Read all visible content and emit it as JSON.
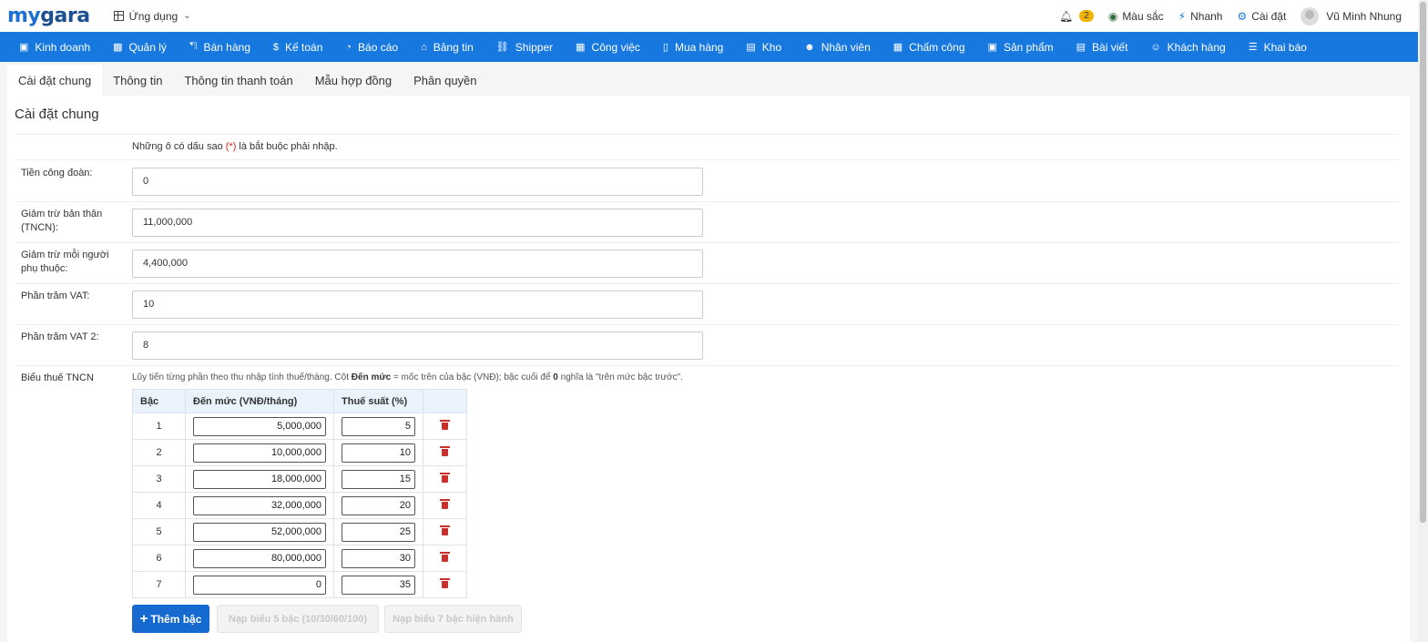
{
  "brand": {
    "logo_my": "my",
    "logo_gara": "gara"
  },
  "topbar": {
    "apps_label": "Ứng dụng",
    "notification_count": "2",
    "color_label": "Màu sắc",
    "quick_label": "Nhanh",
    "settings_label": "Cài đặt",
    "user_name": "Vũ Minh Nhung"
  },
  "nav": [
    {
      "label": "Kinh doanh",
      "icon": "briefcase-icon"
    },
    {
      "label": "Quản lý",
      "icon": "id-card-icon"
    },
    {
      "label": "Bán hàng",
      "icon": "cart-icon"
    },
    {
      "label": "Kế toán",
      "icon": "dollar-icon"
    },
    {
      "label": "Báo cáo",
      "icon": "pie-chart-icon"
    },
    {
      "label": "Bảng tin",
      "icon": "home-icon"
    },
    {
      "label": "Shipper",
      "icon": "truck-icon"
    },
    {
      "label": "Công việc",
      "icon": "calendar-icon"
    },
    {
      "label": "Mua hàng",
      "icon": "basket-icon"
    },
    {
      "label": "Kho",
      "icon": "warehouse-icon"
    },
    {
      "label": "Nhân viên",
      "icon": "user-icon"
    },
    {
      "label": "Chấm công",
      "icon": "calendar-check-icon"
    },
    {
      "label": "Sản phẩm",
      "icon": "box-icon"
    },
    {
      "label": "Bài viết",
      "icon": "newspaper-icon"
    },
    {
      "label": "Khách hàng",
      "icon": "smile-icon"
    },
    {
      "label": "Khai báo",
      "icon": "list-icon"
    }
  ],
  "tabs": [
    {
      "label": "Cài đặt chung",
      "active": true
    },
    {
      "label": "Thông tin"
    },
    {
      "label": "Thông tin thanh toán"
    },
    {
      "label": "Mẫu hợp đồng"
    },
    {
      "label": "Phân quyền"
    }
  ],
  "panel": {
    "title": "Cài đặt chung",
    "required_note_pre": "Những ô có dấu sao ",
    "required_note_star": "(*)",
    "required_note_post": " là bắt buộc phải nhập.",
    "fields": {
      "union_fee": {
        "label": "Tiền công đoàn:",
        "value": "0"
      },
      "self_deduction": {
        "label": "Giảm trừ bản thân (TNCN):",
        "value": "11,000,000"
      },
      "dependent_deduction": {
        "label": "Giảm trừ mỗi người phụ thuộc:",
        "value": "4,400,000"
      },
      "vat_percent": {
        "label": "Phần trăm VAT:",
        "value": "10"
      },
      "vat_percent_2": {
        "label": "Phần trăm VAT 2:",
        "value": "8"
      }
    },
    "tax_table": {
      "label": "Biểu thuế TNCN",
      "desc_1": "Lũy tiến từng phần theo thu nhập tính thuế/tháng. Cột ",
      "desc_bold_1": "Đến mức",
      "desc_2": " = mốc trên của bậc (VNĐ); bậc cuối để ",
      "desc_bold_2": "0",
      "desc_3": " nghĩa là \"trên mức bậc trước\".",
      "headers": {
        "level": "Bậc",
        "up_to": "Đến mức (VNĐ/tháng)",
        "rate": "Thuế suất (%)"
      },
      "rows": [
        {
          "level": "1",
          "up_to": "5,000,000",
          "rate": "5"
        },
        {
          "level": "2",
          "up_to": "10,000,000",
          "rate": "10"
        },
        {
          "level": "3",
          "up_to": "18,000,000",
          "rate": "15"
        },
        {
          "level": "4",
          "up_to": "32,000,000",
          "rate": "20"
        },
        {
          "level": "5",
          "up_to": "52,000,000",
          "rate": "25"
        },
        {
          "level": "6",
          "up_to": "80,000,000",
          "rate": "30"
        },
        {
          "level": "7",
          "up_to": "0",
          "rate": "35"
        }
      ],
      "add_button": "Thêm bậc",
      "load_5_button": "Nạp biểu 5 bậc (10/30/60/100)",
      "load_7_button": "Nạp biểu 7 bậc hiện hành"
    }
  }
}
